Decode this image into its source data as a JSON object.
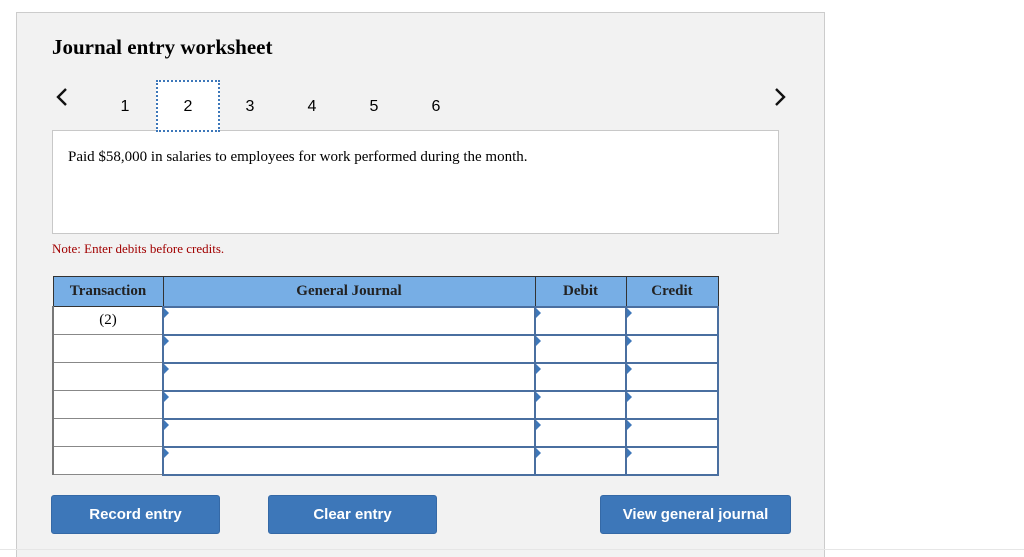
{
  "title": "Journal entry worksheet",
  "nav": {
    "prev_icon": "chevron-left-icon",
    "next_icon": "chevron-right-icon",
    "tabs": [
      "1",
      "2",
      "3",
      "4",
      "5",
      "6"
    ],
    "active_tab": "2"
  },
  "description": "Paid $58,000 in salaries to employees for work performed during the month.",
  "note": "Note: Enter debits before credits.",
  "table": {
    "headers": [
      "Transaction",
      "General Journal",
      "Debit",
      "Credit"
    ],
    "rows": [
      {
        "transaction": "(2)",
        "account": "",
        "debit": "",
        "credit": ""
      },
      {
        "transaction": "",
        "account": "",
        "debit": "",
        "credit": ""
      },
      {
        "transaction": "",
        "account": "",
        "debit": "",
        "credit": ""
      },
      {
        "transaction": "",
        "account": "",
        "debit": "",
        "credit": ""
      },
      {
        "transaction": "",
        "account": "",
        "debit": "",
        "credit": ""
      },
      {
        "transaction": "",
        "account": "",
        "debit": "",
        "credit": ""
      }
    ]
  },
  "buttons": {
    "record": "Record entry",
    "clear": "Clear entry",
    "view": "View general journal"
  },
  "colors": {
    "accent": "#3d77b9",
    "header_bg": "#77aee5",
    "note": "#a10000"
  }
}
